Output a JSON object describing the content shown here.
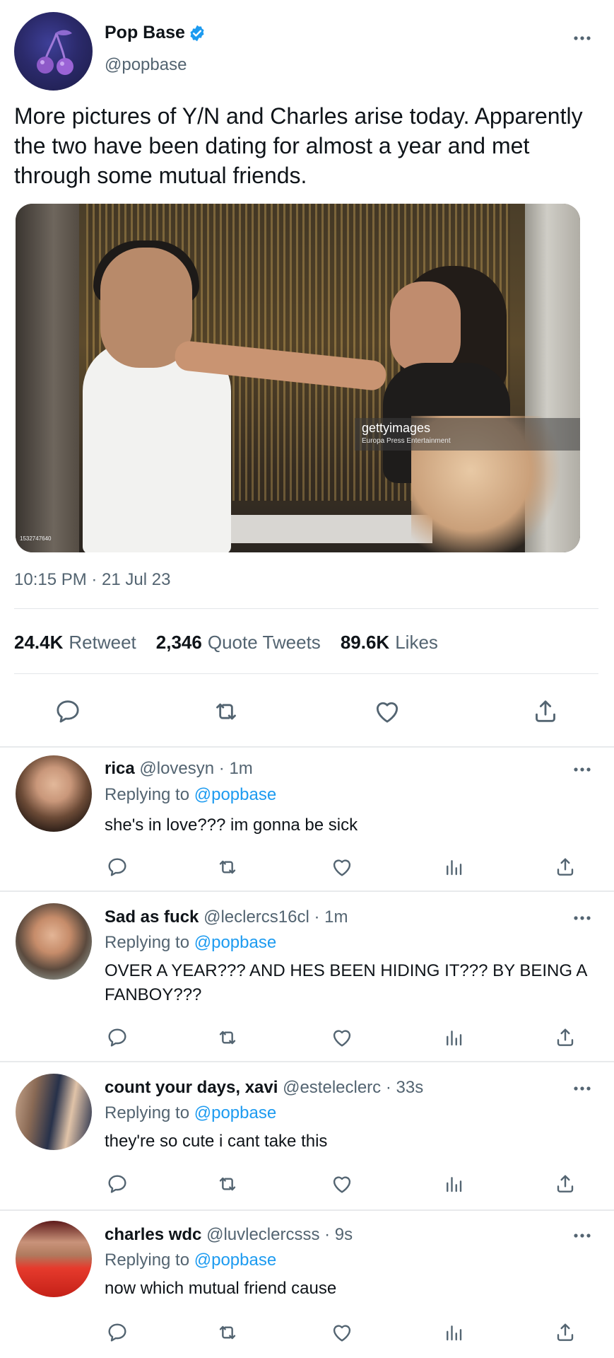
{
  "tweet": {
    "author_name": "Pop Base",
    "author_handle": "@popbase",
    "verified": true,
    "text": "More pictures of Y/N and Charles arise today. Apparently the two have been dating for almost a year and met through some mutual friends.",
    "media": {
      "watermark_brand": "gettyimages",
      "watermark_sub": "Europa Press Entertainment",
      "image_id": "1532747640"
    },
    "timestamp": "10:15 PM · 21 Jul 23",
    "stats": {
      "retweets_count": "24.4K",
      "retweets_label": "Retweet",
      "quotes_count": "2,346",
      "quotes_label": "Quote Tweets",
      "likes_count": "89.6K",
      "likes_label": "Likes"
    }
  },
  "replies": [
    {
      "name": "rica",
      "handle": "@lovesyn · 1m",
      "replying_prefix": "Replying to",
      "replying_to": "@popbase",
      "text": "she's in love??? im gonna be sick"
    },
    {
      "name": "Sad as fuck",
      "handle": "@leclercs16cl · 1m",
      "replying_prefix": "Replying to",
      "replying_to": "@popbase",
      "text": "OVER A YEAR??? AND HES BEEN HIDING IT??? BY BEING A FANBOY???"
    },
    {
      "name": "count your days, xavi",
      "handle": "@esteleclerc · 33s",
      "replying_prefix": "Replying to",
      "replying_to": "@popbase",
      "text": "they're so cute i cant take this"
    },
    {
      "name": "charles wdc",
      "handle": "@luvleclercsss · 9s",
      "replying_prefix": "Replying to",
      "replying_to": "@popbase",
      "text": "now which mutual friend cause"
    }
  ],
  "icons": {
    "reply": "reply-icon",
    "retweet": "retweet-icon",
    "like": "heart-icon",
    "share": "share-icon",
    "analytics": "analytics-icon",
    "more": "more-options-icon",
    "verified": "verified-badge-icon",
    "avatar_logo": "cherries-icon"
  },
  "colors": {
    "accent": "#1d9bf0",
    "secondary_text": "#536471",
    "primary_text": "#0f1419",
    "icon": "#536471"
  }
}
